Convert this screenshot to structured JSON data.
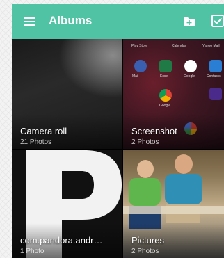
{
  "app": {
    "title": "Albums",
    "header_color": "#4fc3a3"
  },
  "icons": {
    "menu": "menu-icon",
    "new_folder": "new-folder-icon",
    "select": "check-box-icon"
  },
  "albums": [
    {
      "name": "Camera roll",
      "count": "21 Photos"
    },
    {
      "name": "Screenshot",
      "count": "2 Photos"
    },
    {
      "name": "com.pandora.andr…",
      "count": "1 Photo"
    },
    {
      "name": "Pictures",
      "count": "2 Photos"
    }
  ],
  "screenshot_apps": [
    "Play Store",
    "Calendar",
    "Yahoo Mail",
    "Mail",
    "Excel",
    "Google",
    "Contacts",
    "Google",
    "Photos",
    "Phone"
  ]
}
